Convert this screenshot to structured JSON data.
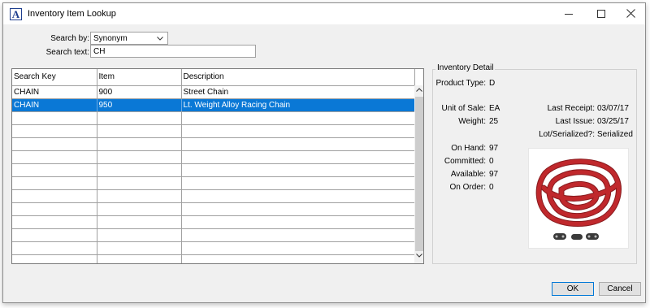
{
  "window": {
    "title": "Inventory Item Lookup"
  },
  "search": {
    "by_label": "Search by:",
    "by_value": "Synonym",
    "text_label": "Search text:",
    "text_value": "CH"
  },
  "grid": {
    "columns": [
      "Search Key",
      "Item",
      "Description"
    ],
    "rows": [
      [
        "CHAIN",
        "900",
        "Street Chain"
      ],
      [
        "CHAIN",
        "950",
        "Lt. Weight Alloy Racing Chain"
      ]
    ],
    "selected_row": 1,
    "empty_rows": 12
  },
  "detail": {
    "legend": "Inventory Detail",
    "product_type_label": "Product Type:",
    "product_type": "D",
    "unit_of_sale_label": "Unit of Sale:",
    "unit_of_sale": "EA",
    "weight_label": "Weight:",
    "weight": "25",
    "last_receipt_label": "Last Receipt:",
    "last_receipt": "03/07/17",
    "last_issue_label": "Last Issue:",
    "last_issue": "03/25/17",
    "lot_serialized_label": "Lot/Serialized?:",
    "lot_serialized": "Serialized",
    "on_hand_label": "On Hand:",
    "on_hand": "97",
    "committed_label": "Committed:",
    "committed": "0",
    "available_label": "Available:",
    "available": "97",
    "on_order_label": "On Order:",
    "on_order": "0"
  },
  "buttons": {
    "ok": "OK",
    "cancel": "Cancel"
  },
  "colors": {
    "selection": "#0a78d6",
    "chain_red": "#c0282c"
  }
}
